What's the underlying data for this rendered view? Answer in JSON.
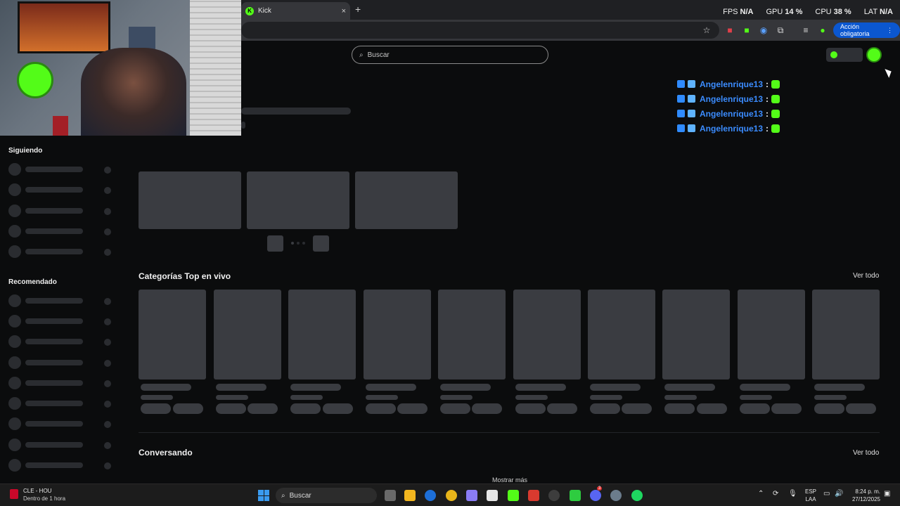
{
  "browser": {
    "tab_title": "Kick",
    "tab_close": "×",
    "new_tab": "+",
    "action_button": "Acción obligatoria",
    "stats": [
      {
        "label": "FPS",
        "value": "N/A"
      },
      {
        "label": "GPU",
        "value": "14 %"
      },
      {
        "label": "CPU",
        "value": "38 %"
      },
      {
        "label": "LAT",
        "value": "N/A"
      }
    ]
  },
  "page": {
    "search_placeholder": "Buscar",
    "chat": [
      {
        "name": "Angelenrique13",
        "sep": ":"
      },
      {
        "name": "Angelenrique13",
        "sep": ":"
      },
      {
        "name": "Angelenrique13",
        "sep": ":"
      },
      {
        "name": "Angelenrique13",
        "sep": ":"
      }
    ],
    "sidebar": {
      "following_title": "Siguiendo",
      "recommended_title": "Recomendado"
    },
    "sections": {
      "top_categories": {
        "title": "Categorías Top en vivo",
        "see_all": "Ver todo"
      },
      "chatting": {
        "title": "Conversando",
        "see_all": "Ver todo"
      }
    },
    "show_more": "Mostrar más"
  },
  "taskbar": {
    "widget_title": "CLE - HOU",
    "widget_subtitle": "Dentro de 1 hora",
    "search_label": "Buscar",
    "lang_top": "ESP",
    "lang_bottom": "LAA",
    "time": "8:24 p. m.",
    "date": "27/12/2025",
    "notification_badge": "3"
  },
  "colors": {
    "kick_green": "#53fc18",
    "accent_blue": "#0b57d0",
    "chat_name": "#3b8cff",
    "skeleton": "#3a3c41"
  }
}
